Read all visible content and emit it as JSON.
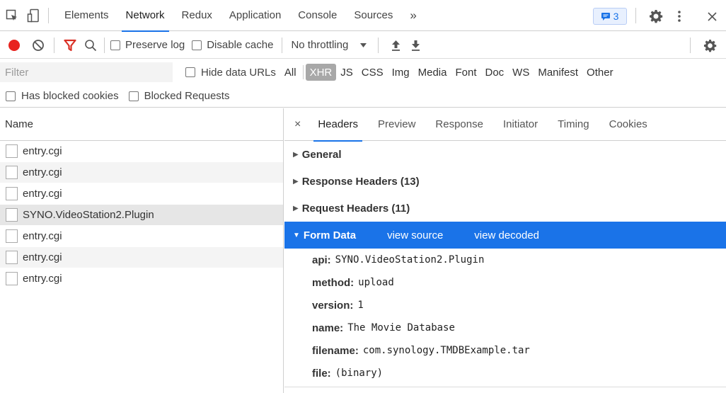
{
  "tabs": [
    "Elements",
    "Network",
    "Redux",
    "Application",
    "Console",
    "Sources"
  ],
  "more_tabs": "»",
  "badge_count": "3",
  "toolbar": {
    "preserve_log": "Preserve log",
    "disable_cache": "Disable cache",
    "throttling": "No throttling"
  },
  "filter": {
    "placeholder": "Filter",
    "hide_data_urls": "Hide data URLs",
    "types": [
      "All",
      "XHR",
      "JS",
      "CSS",
      "Img",
      "Media",
      "Font",
      "Doc",
      "WS",
      "Manifest",
      "Other"
    ],
    "selected_type": "XHR",
    "has_blocked_cookies": "Has blocked cookies",
    "blocked_requests": "Blocked Requests"
  },
  "requests": {
    "column": "Name",
    "items": [
      "entry.cgi",
      "entry.cgi",
      "entry.cgi",
      "SYNO.VideoStation2.Plugin",
      "entry.cgi",
      "entry.cgi",
      "entry.cgi"
    ]
  },
  "detail": {
    "close": "×",
    "tabs": [
      "Headers",
      "Preview",
      "Response",
      "Initiator",
      "Timing",
      "Cookies"
    ],
    "sections": {
      "general": "General",
      "response_headers": "Response Headers (13)",
      "request_headers": "Request Headers (11)",
      "form_data": "Form Data",
      "view_source": "view source",
      "view_decoded": "view decoded"
    },
    "form_data": [
      {
        "key": "api:",
        "value": "SYNO.VideoStation2.Plugin"
      },
      {
        "key": "method:",
        "value": "upload"
      },
      {
        "key": "version:",
        "value": "1"
      },
      {
        "key": "name:",
        "value": "The Movie Database"
      },
      {
        "key": "filename:",
        "value": "com.synology.TMDBExample.tar"
      },
      {
        "key": "file:",
        "value": "(binary)"
      }
    ]
  },
  "colors": {
    "accent": "#1a73e8",
    "record": "#e8231e",
    "filter_icon": "#d93025",
    "selected_row": "#e6e6e6"
  }
}
